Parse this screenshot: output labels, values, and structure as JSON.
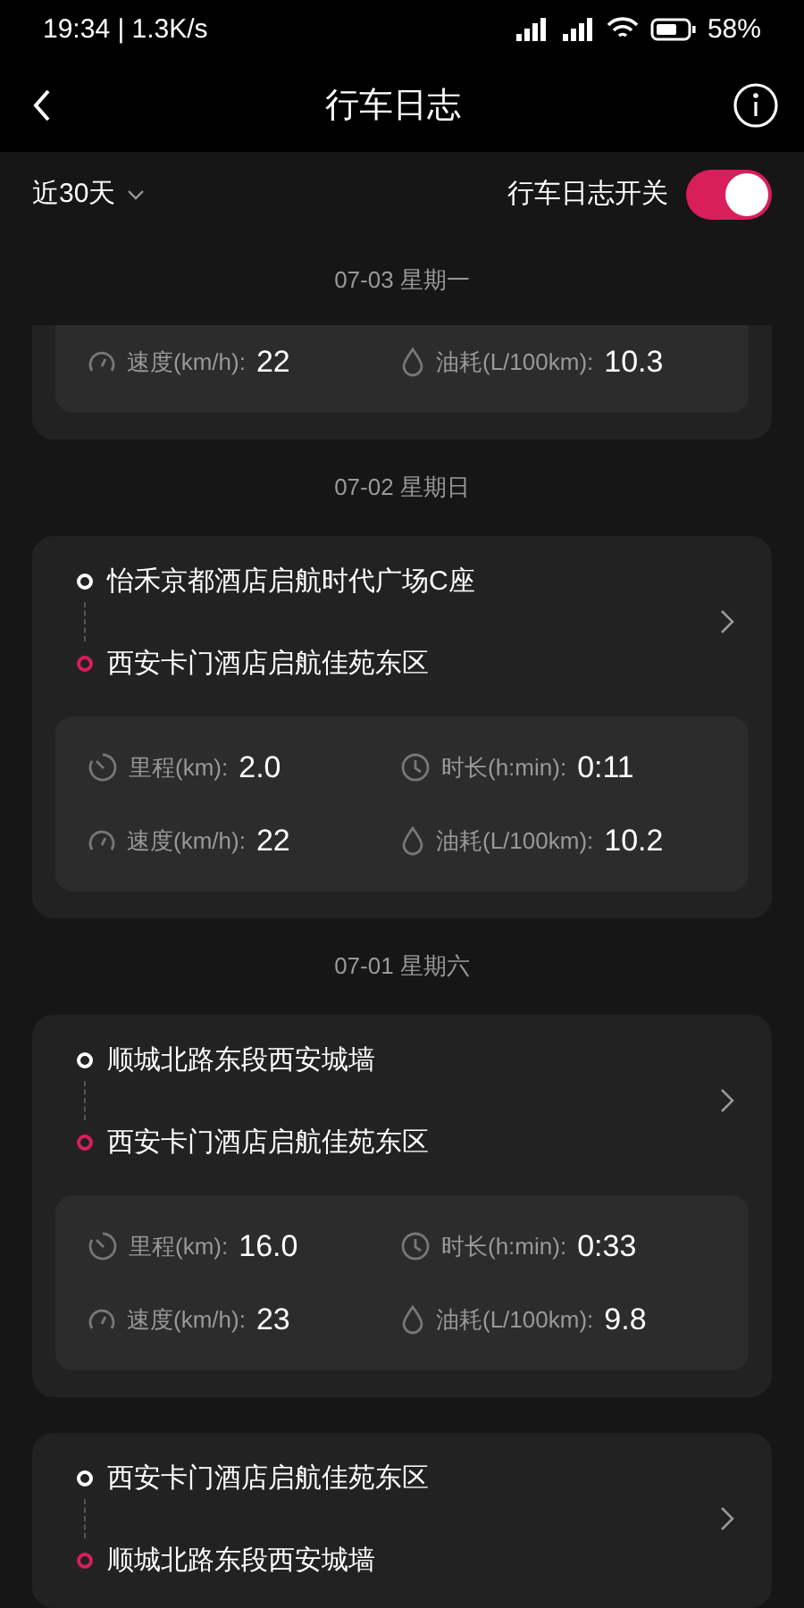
{
  "status_bar": {
    "time": "19:34 | 1.3K/s",
    "battery": "58%"
  },
  "header": {
    "title": "行车日志"
  },
  "filter": {
    "range": "近30天",
    "switch_label": "行车日志开关",
    "switch_on": true
  },
  "days": [
    {
      "date": "07-03 星期一",
      "trips": [
        {
          "cut_top": true,
          "stats": [
            {
              "kind": "speed",
              "label": "速度(km/h):",
              "value": "22"
            },
            {
              "kind": "fuel",
              "label": "油耗(L/100km):",
              "value": "10.3"
            }
          ]
        }
      ]
    },
    {
      "date": "07-02 星期日",
      "trips": [
        {
          "from": "怡禾京都酒店启航时代广场C座",
          "to": "西安卡门酒店启航佳苑东区",
          "stats": [
            {
              "kind": "distance",
              "label": "里程(km):",
              "value": "2.0"
            },
            {
              "kind": "duration",
              "label": "时长(h:min):",
              "value": "0:11"
            },
            {
              "kind": "speed",
              "label": "速度(km/h):",
              "value": "22"
            },
            {
              "kind": "fuel",
              "label": "油耗(L/100km):",
              "value": "10.2"
            }
          ]
        }
      ]
    },
    {
      "date": "07-01 星期六",
      "trips": [
        {
          "from": "顺城北路东段西安城墙",
          "to": "西安卡门酒店启航佳苑东区",
          "stats": [
            {
              "kind": "distance",
              "label": "里程(km):",
              "value": "16.0"
            },
            {
              "kind": "duration",
              "label": "时长(h:min):",
              "value": "0:33"
            },
            {
              "kind": "speed",
              "label": "速度(km/h):",
              "value": "23"
            },
            {
              "kind": "fuel",
              "label": "油耗(L/100km):",
              "value": "9.8"
            }
          ]
        },
        {
          "from": "西安卡门酒店启航佳苑东区",
          "to": "顺城北路东段西安城墙"
        }
      ]
    }
  ]
}
